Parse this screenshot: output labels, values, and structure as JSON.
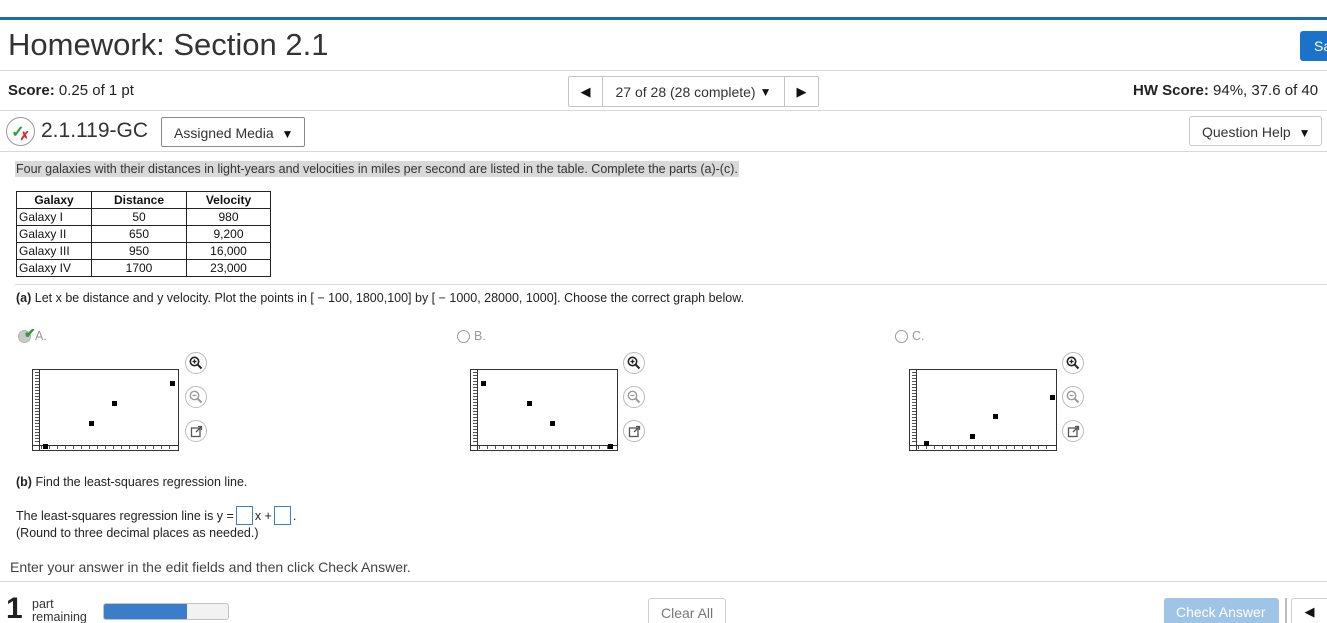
{
  "page": {
    "title": "Homework: Section 2.1",
    "save_label": "Sa"
  },
  "score": {
    "label": "Score:",
    "value": "0.25 of 1 pt"
  },
  "nav": {
    "position": "27 of 28 (28 complete)",
    "prev_icon": "caret-left-icon",
    "next_icon": "caret-right-icon"
  },
  "hw_score": {
    "label": "HW Score:",
    "value": "94%, 37.6 of 40"
  },
  "question": {
    "id": "2.1.119-GC",
    "media_label": "Assigned Media",
    "help_label": "Question Help",
    "prompt": "Four galaxies with their distances in light-years and velocities in miles per second are listed in the table. Complete the parts (a)-(c).",
    "table": {
      "headers": [
        "Galaxy",
        "Distance",
        "Velocity"
      ],
      "rows": [
        [
          "Galaxy I",
          "50",
          "980"
        ],
        [
          "Galaxy II",
          "650",
          "9,200"
        ],
        [
          "Galaxy III",
          "950",
          "16,000"
        ],
        [
          "Galaxy IV",
          "1700",
          "23,000"
        ]
      ]
    },
    "part_a": {
      "tag": "(a)",
      "text": "Let x be distance and y velocity. Plot the points in [ − 100, 1800,100] by [ − 1000, 28000, 1000]. Choose the correct graph below."
    },
    "options": [
      {
        "label": "A.",
        "selected": true
      },
      {
        "label": "B.",
        "selected": false
      },
      {
        "label": "C.",
        "selected": false
      }
    ],
    "part_b": {
      "tag": "(b)",
      "text": "Find the least-squares regression line.",
      "line_prefix": "The least-squares regression line is y =",
      "line_mid": "x +",
      "line_end": ".",
      "note": "(Round to three decimal places as needed.)"
    }
  },
  "instructions": "Enter your answer in the edit fields and then click Check Answer.",
  "footer": {
    "parts_count": "1",
    "parts_label_1": "part",
    "parts_label_2": "remaining",
    "progress_fraction": 0.67,
    "clear_label": "Clear All",
    "check_label": "Check Answer"
  },
  "colors": {
    "accent": "#1c6f9c",
    "save_button": "#1a73c8",
    "check_button": "#9fc4e6",
    "progress": "#3b7dc9",
    "correct": "#2e9a3a",
    "incorrect": "#d42b2b"
  }
}
